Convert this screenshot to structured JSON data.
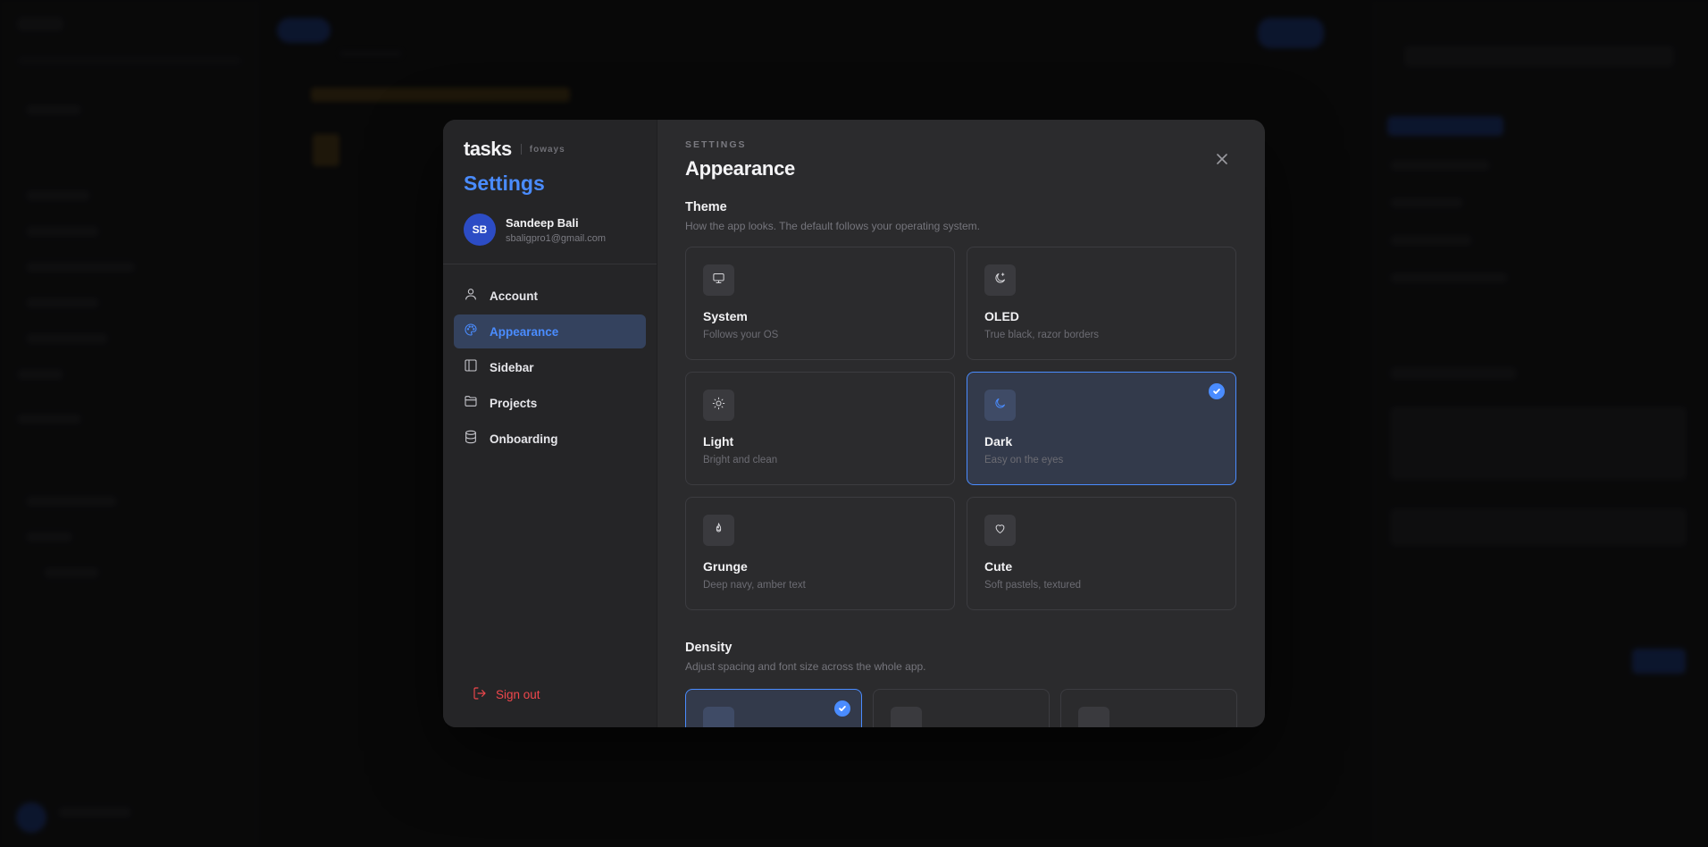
{
  "brand": {
    "name": "tasks",
    "org": "foways"
  },
  "sidebar": {
    "title": "Settings",
    "user": {
      "initials": "SB",
      "name": "Sandeep Bali",
      "email": "sbaligpro1@gmail.com"
    },
    "items": [
      {
        "label": "Account",
        "icon": "user-icon",
        "active": false
      },
      {
        "label": "Appearance",
        "icon": "palette-icon",
        "active": true
      },
      {
        "label": "Sidebar",
        "icon": "sidebar-icon",
        "active": false
      },
      {
        "label": "Projects",
        "icon": "folder-icon",
        "active": false
      },
      {
        "label": "Onboarding",
        "icon": "database-icon",
        "active": false
      }
    ],
    "signout_label": "Sign out"
  },
  "main": {
    "eyebrow": "SETTINGS",
    "title": "Appearance",
    "theme": {
      "title": "Theme",
      "description": "How the app looks. The default follows your operating system.",
      "options": [
        {
          "name": "System",
          "desc": "Follows your OS",
          "icon": "monitor-icon",
          "selected": false
        },
        {
          "name": "OLED",
          "desc": "True black, razor borders",
          "icon": "moon-star-icon",
          "selected": false
        },
        {
          "name": "Light",
          "desc": "Bright and clean",
          "icon": "sun-icon",
          "selected": false
        },
        {
          "name": "Dark",
          "desc": "Easy on the eyes",
          "icon": "moon-icon",
          "selected": true
        },
        {
          "name": "Grunge",
          "desc": "Deep navy, amber text",
          "icon": "flame-icon",
          "selected": false
        },
        {
          "name": "Cute",
          "desc": "Soft pastels, textured",
          "icon": "heart-icon",
          "selected": false
        }
      ]
    },
    "density": {
      "title": "Density",
      "description": "Adjust spacing and font size across the whole app.",
      "selected_index": 0
    }
  },
  "colors": {
    "accent": "#4a8cff",
    "danger": "#f0474c",
    "modal_bg": "#2b2b2d"
  }
}
